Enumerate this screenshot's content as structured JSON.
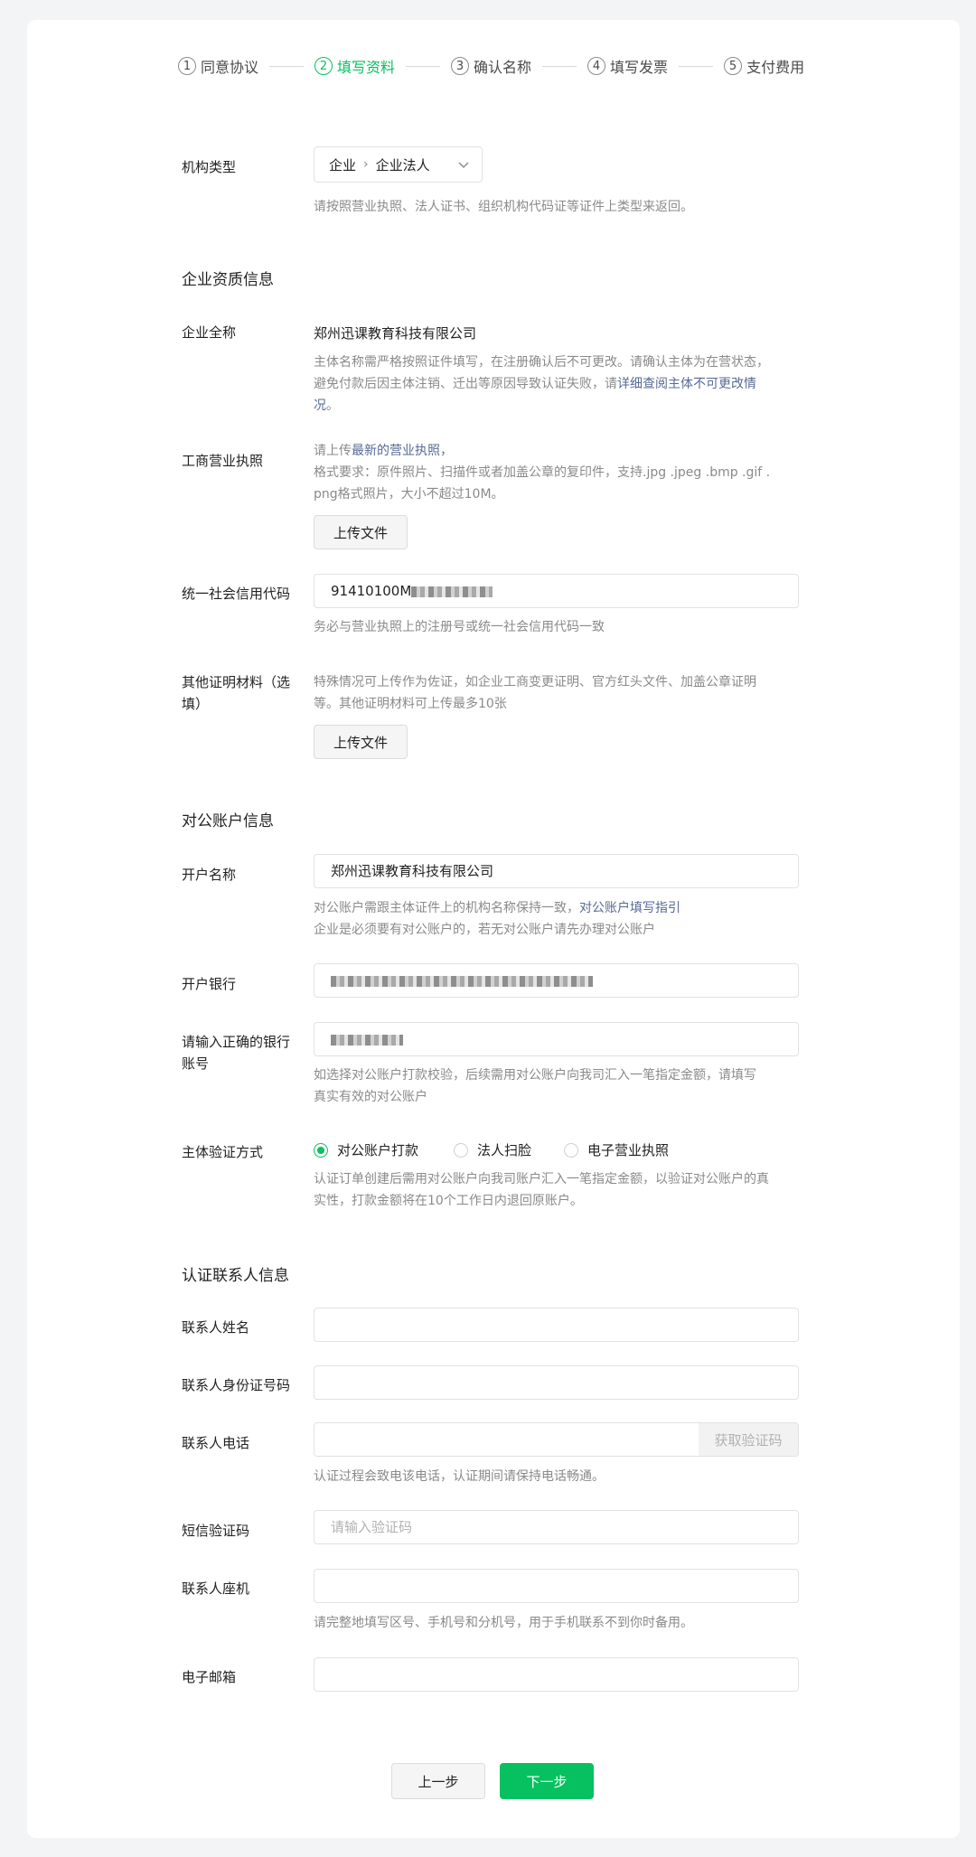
{
  "steps": [
    {
      "num": "1",
      "label": "同意协议",
      "active": false
    },
    {
      "num": "2",
      "label": "填写资料",
      "active": true
    },
    {
      "num": "3",
      "label": "确认名称",
      "active": false
    },
    {
      "num": "4",
      "label": "填写发票",
      "active": false
    },
    {
      "num": "5",
      "label": "支付费用",
      "active": false
    }
  ],
  "org_type": {
    "label": "机构类型",
    "level1": "企业",
    "level2": "企业法人",
    "help": "请按照营业执照、法人证书、组织机构代码证等证件上类型来返回。"
  },
  "qualification": {
    "section_title": "企业资质信息",
    "full_name_label": "企业全称",
    "full_name_value": "郑州迅课教育科技有限公司",
    "full_name_help_1": "主体名称需严格按照证件填写，在注册确认后不可更改。请确认主体为在营状态，",
    "full_name_help_2": "避免付款后因主体注销、迁出等原因导致认证失败，请",
    "full_name_help_link_a": "详细查阅主体不可更改情",
    "full_name_help_link_b": "况",
    "full_name_help_end": "。",
    "license_label": "工商营业执照",
    "license_help_1": "请上传",
    "license_help_link": "最新的营业执照",
    "license_help_1_end": "，",
    "license_help_2": "格式要求：原件照片、扫描件或者加盖公章的复印件，支持.jpg .jpeg .bmp .gif .",
    "license_help_3": "png格式照片，大小不超过10M。",
    "upload_label": "上传文件",
    "credit_code_label": "统一社会信用代码",
    "credit_code_value": "91410100M",
    "credit_code_help": "务必与营业执照上的注册号或统一社会信用代码一致",
    "other_docs_label_1": "其他证明材料（选",
    "other_docs_label_2": "填）",
    "other_docs_help_1": "特殊情况可上传作为佐证，如企业工商变更证明、官方红头文件、加盖公章证明",
    "other_docs_help_2": "等。其他证明材料可上传最多10张",
    "other_upload_label": "上传文件"
  },
  "account": {
    "section_title": "对公账户信息",
    "name_label": "开户名称",
    "name_value": "郑州迅课教育科技有限公司",
    "name_help_1": "对公账户需跟主体证件上的机构名称保持一致，",
    "name_help_link": "对公账户填写指引",
    "name_help_2": "企业是必须要有对公账户的，若无对公账户请先办理对公账户",
    "bank_label": "开户银行",
    "account_no_label_1": "请输入正确的银行",
    "account_no_label_2": "账号",
    "account_no_help_1": "如选择对公账户打款校验，后续需用对公账户向我司汇入一笔指定金额，请填写",
    "account_no_help_2": "真实有效的对公账户",
    "verify_label": "主体验证方式",
    "verify_options": [
      "对公账户打款",
      "法人扫脸",
      "电子营业执照"
    ],
    "verify_selected": "对公账户打款",
    "verify_help_1": "认证订单创建后需用对公账户向我司账户汇入一笔指定金额，以验证对公账户的真",
    "verify_help_2": "实性，打款金额将在10个工作日内退回原账户。"
  },
  "contact": {
    "section_title": "认证联系人信息",
    "name_label": "联系人姓名",
    "id_label": "联系人身份证号码",
    "phone_label": "联系人电话",
    "get_code_label": "获取验证码",
    "phone_help": "认证过程会致电该电话，认证期间请保持电话畅通。",
    "sms_label": "短信验证码",
    "sms_placeholder": "请输入验证码",
    "landline_label": "联系人座机",
    "landline_help": "请完整地填写区号、手机号和分机号，用于手机联系不到你时备用。",
    "email_label": "电子邮箱"
  },
  "footer": {
    "prev_label": "上一步",
    "next_label": "下一步"
  },
  "colors": {
    "accent": "#07c160",
    "link": "#576b95",
    "help": "#8a8a8a",
    "background": "#f3f4f6"
  }
}
